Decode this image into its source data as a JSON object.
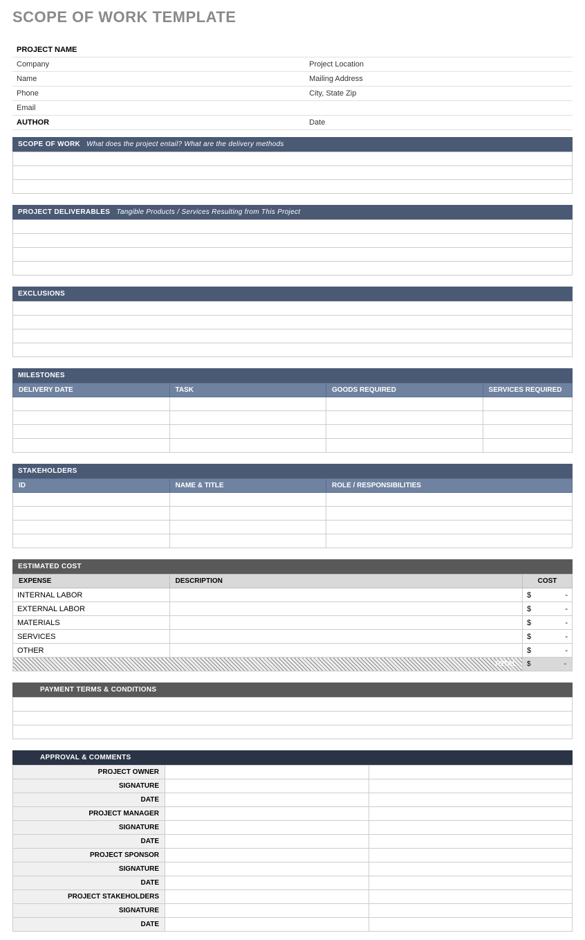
{
  "title": "SCOPE OF WORK TEMPLATE",
  "header": {
    "projectName": "PROJECT NAME",
    "company": "Company",
    "name": "Name",
    "phone": "Phone",
    "email": "Email",
    "author": "AUTHOR",
    "projectLocation": "Project Location",
    "mailingAddress": "Mailing Address",
    "cityStateZip": "City, State Zip",
    "date": "Date"
  },
  "sections": {
    "scopeOfWork": {
      "label": "SCOPE OF WORK",
      "hint": "What does the project entail? What are the delivery methods"
    },
    "deliverables": {
      "label": "PROJECT DELIVERABLES",
      "hint": "Tangible Products / Services Resulting from This Project"
    },
    "exclusions": {
      "label": "EXCLUSIONS"
    },
    "milestones": {
      "label": "MILESTONES",
      "cols": {
        "deliveryDate": "DELIVERY DATE",
        "task": "TASK",
        "goods": "GOODS REQUIRED",
        "services": "SERVICES REQUIRED"
      }
    },
    "stakeholders": {
      "label": "STAKEHOLDERS",
      "cols": {
        "id": "ID",
        "nameTitle": "NAME & TITLE",
        "role": "ROLE / RESPONSIBILITIES"
      }
    },
    "estimatedCost": {
      "label": "ESTIMATED COST",
      "cols": {
        "expense": "EXPENSE",
        "description": "DESCRIPTION",
        "cost": "COST"
      },
      "rows": [
        "INTERNAL LABOR",
        "EXTERNAL LABOR",
        "MATERIALS",
        "SERVICES",
        "OTHER"
      ],
      "currency": "$",
      "dash": "-",
      "total": "TOTAL"
    },
    "paymentTerms": {
      "label": "PAYMENT TERMS & CONDITIONS"
    },
    "approval": {
      "label": "APPROVAL & COMMENTS",
      "roles": [
        "PROJECT OWNER",
        "SIGNATURE",
        "DATE",
        "PROJECT MANAGER",
        "SIGNATURE",
        "DATE",
        "PROJECT SPONSOR",
        "SIGNATURE",
        "DATE",
        "PROJECT STAKEHOLDERS",
        "SIGNATURE",
        "DATE"
      ]
    }
  }
}
